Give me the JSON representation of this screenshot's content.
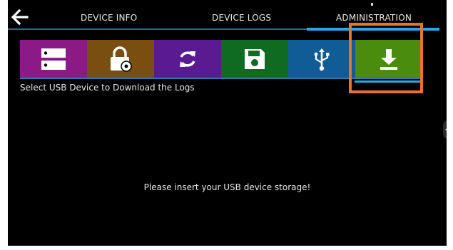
{
  "header": {
    "back_icon": "arrow-left-icon",
    "tabs": [
      {
        "label": "DEVICE INFO",
        "active": false
      },
      {
        "label": "DEVICE LOGS",
        "active": false
      },
      {
        "label": "ADMINISTRATION",
        "active": true
      }
    ]
  },
  "toolbar": {
    "items": [
      {
        "icon": "server-icon",
        "color": "#8c1a86"
      },
      {
        "icon": "lock-settings-icon",
        "color": "#7a4d10"
      },
      {
        "icon": "sync-icon",
        "color": "#5a1a91"
      },
      {
        "icon": "save-icon",
        "color": "#0f6b22"
      },
      {
        "icon": "usb-icon",
        "color": "#0f5c96"
      },
      {
        "icon": "download-icon",
        "color": "#4a8d0e",
        "selected": true
      }
    ],
    "highlight_color": "#e8742a"
  },
  "content": {
    "instruction": "Select USB Device to Download the Logs",
    "message": "Please insert your USB device storage!"
  },
  "colors": {
    "background": "#000000",
    "accent": "#29a8e6"
  }
}
